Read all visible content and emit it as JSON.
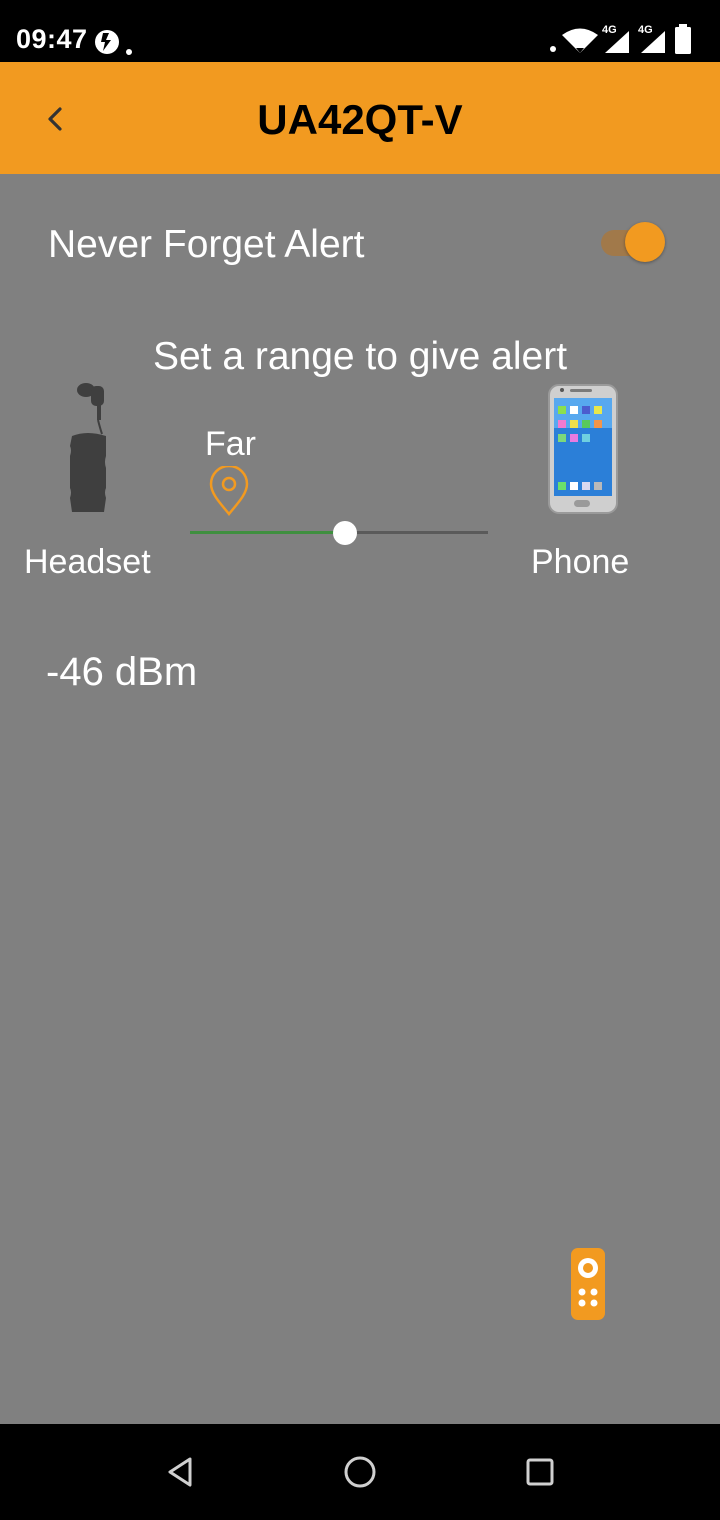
{
  "status_bar": {
    "time": "09:47",
    "network_label_1": "4G",
    "network_label_2": "4G"
  },
  "app_bar": {
    "title": "UA42QT-V",
    "background_color": "#f29a20"
  },
  "alert": {
    "label": "Never Forget Alert",
    "enabled": true
  },
  "range": {
    "title": "Set a range to give alert",
    "marker_label": "Far",
    "slider_fraction": 0.52,
    "left_device_label": "Headset",
    "right_device_label": "Phone"
  },
  "signal": {
    "value": "-46 dBm"
  },
  "icons": {
    "back": "chevron-left-icon",
    "pin": "location-pin-icon",
    "remote": "remote-control-icon",
    "headset": "headset-image",
    "phone": "phone-image",
    "nav_back": "triangle-back-icon",
    "nav_home": "circle-home-icon",
    "nav_recent": "square-recent-icon"
  }
}
